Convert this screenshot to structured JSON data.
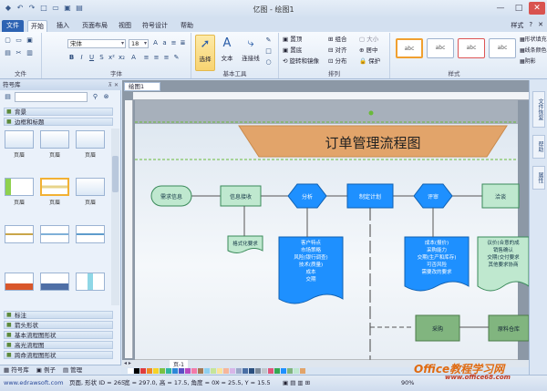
{
  "window": {
    "title": "亿图 - 绘图1",
    "controls": [
      "—",
      "□",
      "✕"
    ]
  },
  "ribbon_tabs": [
    {
      "label": "文件"
    },
    {
      "label": "开始"
    },
    {
      "label": "插入"
    },
    {
      "label": "页面布局"
    },
    {
      "label": "视图"
    },
    {
      "label": "符号设计"
    },
    {
      "label": "帮助"
    }
  ],
  "ribbon_right": {
    "style_label": "样式",
    "help": "?",
    "close": "✕"
  },
  "ribbon": {
    "groups": {
      "file": "文件",
      "font": "字体",
      "basic_tools": "基本工具",
      "arrange": "排列",
      "style": "样式"
    },
    "font_name": "宋体",
    "font_size": "18",
    "buttons": {
      "select": "选择",
      "text": "文本",
      "connector": "连接线",
      "front": "置顶",
      "back": "置底",
      "rotate_mirror": "旋转和镜像",
      "group": "组合",
      "align": "对齐",
      "distribute": "分布",
      "size": "大小",
      "center": "居中",
      "protect": "保护",
      "fill": "形状填充",
      "line": "线条颜色",
      "shadow": "阴影"
    },
    "swatch_text": "abc"
  },
  "left_panel": {
    "title": "符号库",
    "categories_top": [
      "背景",
      "边框和标题"
    ],
    "thumb_label": "页眉",
    "thumbs": [
      "页眉",
      "页眉",
      "页眉",
      "页眉",
      "页眉",
      "页眉",
      "",
      "",
      "",
      "",
      "",
      ""
    ],
    "categories_bottom": [
      "标注",
      "箭头形状",
      "基本流程图形状",
      "高光流程图",
      "跨命流程图形状"
    ],
    "tabs": [
      "符号库",
      "例子",
      "管理"
    ]
  },
  "canvas": {
    "doc_tab": "绘图1",
    "page_tab": "页-1",
    "banner_title": "订单管理流程图",
    "flow": {
      "n1": "需求信息",
      "n2": "信息接收",
      "n3": "分析",
      "n4": "制定计划",
      "n5": "评审",
      "n6": "洽谈",
      "n7": "采购",
      "n8": "原料仓库",
      "note1": "格式化要求",
      "doc1": [
        "客户特点",
        "市场策略",
        "风险(银行调查)",
        "技术(质量)",
        "成本",
        "交期"
      ],
      "doc2": [
        "成本(报价)",
        "采购能力",
        "交期(生产和库存)",
        "可否风险",
        "需要改的要求"
      ],
      "doc3": [
        "议价(合意的成",
        "销售确认",
        "交期(交付要求",
        "其他要求协商"
      ]
    }
  },
  "right_panel": {
    "tabs": [
      "文件恢复",
      "帮助",
      "属性"
    ]
  },
  "status": {
    "site": "www.edrawsoft.com",
    "page_info": "页面, 形状 ID = 265",
    "dims": "宽 = 297.0, 高 = 17.5, 角度 = 0 ◦",
    "pos": "X = 25.5, Y = 15.5",
    "zoom": "90%"
  },
  "watermark": {
    "brand": "Office教程学习网",
    "url": "www.office68.com"
  },
  "colors": {
    "accent": "#2d63b3",
    "banner": "#e5a870",
    "green_node": "#bfe8cf",
    "blue_node": "#1e90ff",
    "process": "#81b57f"
  }
}
